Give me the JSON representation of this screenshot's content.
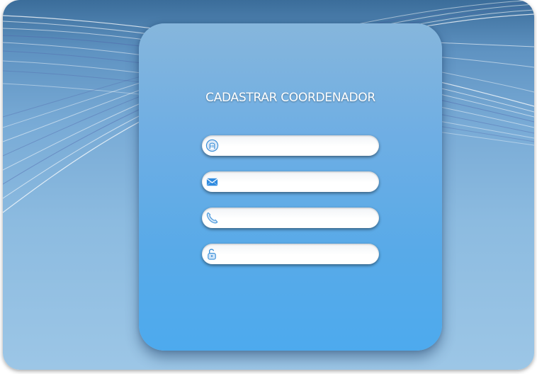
{
  "form": {
    "title": "CADASTRAR COORDENADOR",
    "fields": [
      {
        "name": "nome",
        "icon": "user-icon",
        "value": "",
        "placeholder": ""
      },
      {
        "name": "email",
        "icon": "envelope-icon",
        "value": "",
        "placeholder": ""
      },
      {
        "name": "telefone",
        "icon": "phone-icon",
        "value": "",
        "placeholder": ""
      },
      {
        "name": "senha",
        "icon": "padlock-icon",
        "value": "",
        "placeholder": ""
      }
    ]
  },
  "colors": {
    "card_top": "#86b6dc",
    "card_bottom": "#4daaee",
    "background_top": "#3b6d9a",
    "background_bottom": "#9cc6e6",
    "icon_blue": "#3a8fd8"
  }
}
